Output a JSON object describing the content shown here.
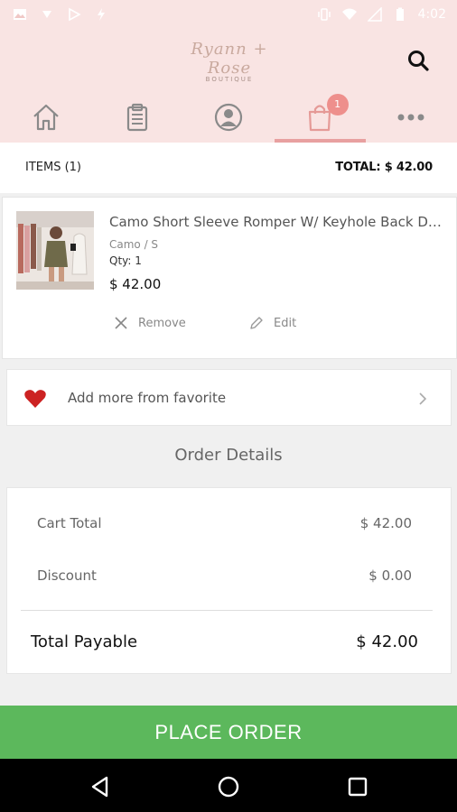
{
  "status_bar": {
    "time": "4:02"
  },
  "header": {
    "logo_script": "Ryann + Rose",
    "logo_sub": "BOUTIQUE",
    "cart_badge": "1"
  },
  "items_bar": {
    "count": "ITEMS (1)",
    "total": "TOTAL: $ 42.00"
  },
  "product": {
    "name": "Camo Short Sleeve Romper W/ Keyhole Back Detail",
    "variant": "Camo / S",
    "qty": "Qty: 1",
    "price": "$ 42.00",
    "remove_label": "Remove",
    "edit_label": "Edit"
  },
  "favorites": {
    "label": "Add more from favorite"
  },
  "order_details": {
    "title": "Order Details",
    "cart_total_label": "Cart Total",
    "cart_total_value": "$ 42.00",
    "discount_label": "Discount",
    "discount_value": "$ 0.00",
    "payable_label": "Total Payable",
    "payable_value": "$ 42.00"
  },
  "place_order": {
    "label": "PLACE ORDER"
  },
  "colors": {
    "header_bg": "#f9e4e3",
    "accent": "#e8a0a0",
    "badge": "#ee8f8c",
    "place_order": "#5cb85c",
    "heart": "#cc2222"
  },
  "icons": [
    "home-icon",
    "clipboard-icon",
    "account-icon",
    "shopping-bag-icon",
    "more-icon",
    "search-icon",
    "close-icon",
    "pencil-icon",
    "heart-icon",
    "chevron-right-icon"
  ]
}
